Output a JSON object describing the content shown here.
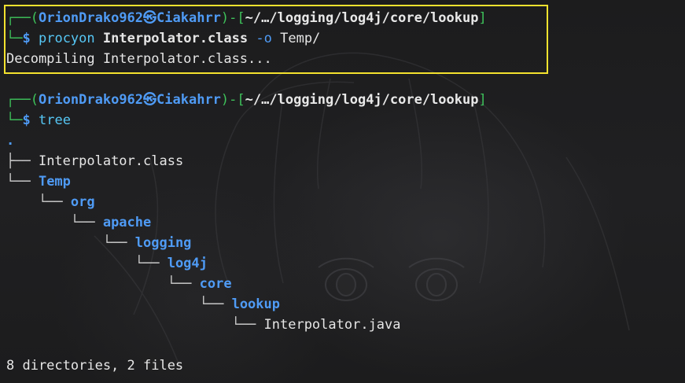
{
  "prompt1": {
    "corner": "┌──",
    "open_paren": "(",
    "user": "OrionDrako962",
    "at_symbol": "㉿",
    "host": "Ciakahrr",
    "close_paren": ")",
    "dash": "-",
    "open_bracket": "[",
    "path": "~/…/logging/log4j/core/lookup",
    "close_bracket": "]",
    "corner2": "└─",
    "dollar": "$",
    "cmd": "procyon",
    "arg1": "Interpolator.class",
    "flag": "-o",
    "arg2": "Temp/"
  },
  "output1": "Decompiling Interpolator.class...",
  "prompt2": {
    "corner": "┌──",
    "open_paren": "(",
    "user": "OrionDrako962",
    "at_symbol": "㉿",
    "host": "Ciakahrr",
    "close_paren": ")",
    "dash": "-",
    "open_bracket": "[",
    "path": "~/…/logging/log4j/core/lookup",
    "close_bracket": "]",
    "corner2": "└─",
    "dollar": "$",
    "cmd": "tree"
  },
  "tree": {
    "root": ".",
    "entries": [
      {
        "prefix": "├── ",
        "name": "Interpolator.class",
        "is_dir": false
      },
      {
        "prefix": "└── ",
        "name": "Temp",
        "is_dir": true
      },
      {
        "prefix": "    └── ",
        "name": "org",
        "is_dir": true
      },
      {
        "prefix": "        └── ",
        "name": "apache",
        "is_dir": true
      },
      {
        "prefix": "            └── ",
        "name": "logging",
        "is_dir": true
      },
      {
        "prefix": "                └── ",
        "name": "log4j",
        "is_dir": true
      },
      {
        "prefix": "                    └── ",
        "name": "core",
        "is_dir": true
      },
      {
        "prefix": "                        └── ",
        "name": "lookup",
        "is_dir": true
      },
      {
        "prefix": "                            └── ",
        "name": "Interpolator.java",
        "is_dir": false
      }
    ],
    "summary": "8 directories, 2 files"
  },
  "colors": {
    "highlight_border": "#f4e22e",
    "prompt_green": "#3ec35b",
    "user_blue": "#4f9bf5",
    "background": "#1b1b1c"
  }
}
